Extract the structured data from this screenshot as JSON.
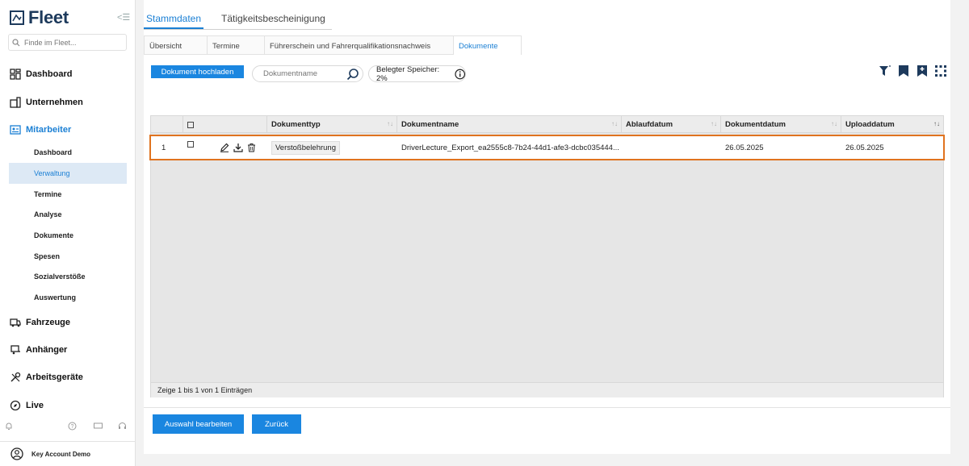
{
  "sidebar": {
    "logo": "Fleet",
    "search_placeholder": "Finde im Fleet...",
    "nav": {
      "dashboard": "Dashboard",
      "unternehmen": "Unternehmen",
      "mitarbeiter": "Mitarbeiter",
      "fahrzeuge": "Fahrzeuge",
      "anhaenger": "Anhänger",
      "arbeitsgeraete": "Arbeitsgeräte",
      "live": "Live"
    },
    "sub_items": [
      "Dashboard",
      "Verwaltung",
      "Termine",
      "Analyse",
      "Dokumente",
      "Spesen",
      "Sozialverstöße",
      "Auswertung"
    ],
    "user": "Key Account Demo"
  },
  "main": {
    "top_tabs": [
      "Stammdaten",
      "Tätigkeitsbescheinigung"
    ],
    "sub_tabs": [
      "Übersicht",
      "Termine",
      "Führerschein und Fahrerqualifikationsnachweis",
      "Dokumente"
    ],
    "upload_label": "Dokument hochladen",
    "doc_search_placeholder": "Dokumentname",
    "storage_label": "Belegter Speicher: 2%",
    "table": {
      "headers": [
        "Dokumenttyp",
        "Dokumentname",
        "Ablaufdatum",
        "Dokumentdatum",
        "Uploaddatum"
      ],
      "row": {
        "index": "1",
        "typ": "Verstoßbelehrung",
        "name": "DriverLecture_Export_ea2555c8-7b24-44d1-afe3-dcbc035444...",
        "ablauf": "",
        "dokumentdatum": "26.05.2025",
        "uploaddatum": "26.05.2025"
      },
      "footer": "Zeige 1 bis 1 von 1 Einträgen"
    },
    "buttons": {
      "edit_selection": "Auswahl bearbeiten",
      "back": "Zurück"
    }
  },
  "colors": {
    "accent": "#1a86e0",
    "highlight": "#e0731f"
  }
}
